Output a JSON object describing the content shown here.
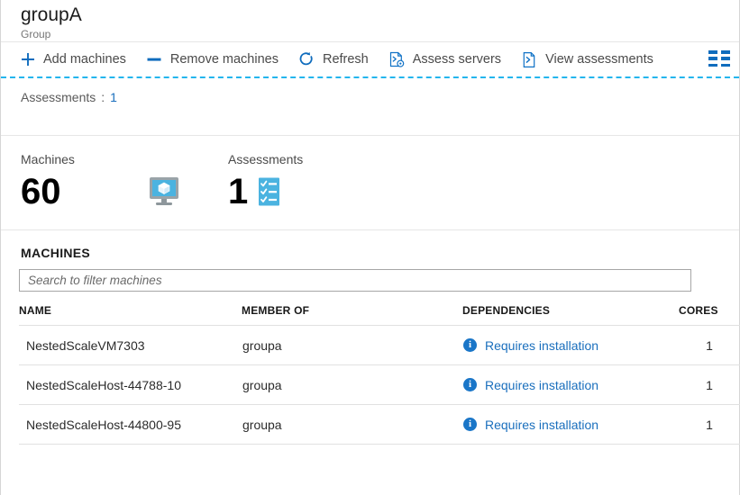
{
  "header": {
    "title": "groupA",
    "subtitle": "Group"
  },
  "toolbar": {
    "items": [
      {
        "label": "Add machines",
        "icon": "plus-icon"
      },
      {
        "label": "Remove machines",
        "icon": "minus-icon"
      },
      {
        "label": "Refresh",
        "icon": "refresh-icon"
      },
      {
        "label": "Assess servers",
        "icon": "assess-servers-icon"
      },
      {
        "label": "View assessments",
        "icon": "view-assessments-icon"
      }
    ],
    "view_toggle_icon": "grid-view-icon"
  },
  "filter": {
    "label": "Assessments",
    "separator": ":",
    "value": "1"
  },
  "stats": [
    {
      "label": "Machines",
      "value": "60",
      "icon": "machine-monitor-icon"
    },
    {
      "label": "Assessments",
      "value": "1",
      "icon": "assessment-checklist-icon"
    }
  ],
  "machines_section": {
    "title": "MACHINES",
    "search_placeholder": "Search to filter machines",
    "search_value": "",
    "columns": [
      "NAME",
      "MEMBER OF",
      "DEPENDENCIES",
      "CORES"
    ],
    "rows": [
      {
        "name": "NestedScaleVM7303",
        "member_of": "groupa",
        "dependencies": "Requires installation",
        "dependencies_icon": "info-icon",
        "cores": "1"
      },
      {
        "name": "NestedScaleHost-44788-10",
        "member_of": "groupa",
        "dependencies": "Requires installation",
        "dependencies_icon": "info-icon",
        "cores": "1"
      },
      {
        "name": "NestedScaleHost-44800-95",
        "member_of": "groupa",
        "dependencies": "Requires installation",
        "dependencies_icon": "info-icon",
        "cores": "1"
      }
    ]
  },
  "colors": {
    "accent_blue": "#0f6cbd",
    "link_blue": "#1a6fbd",
    "dashed_rule": "#23b5ed",
    "icon_blue": "#4bb3e0"
  }
}
